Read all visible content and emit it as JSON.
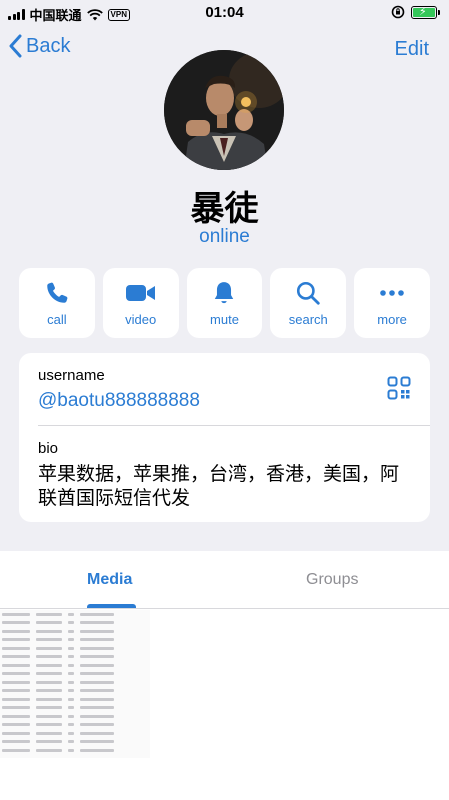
{
  "status_bar": {
    "carrier": "中国联通",
    "vpn": "VPN",
    "time": "01:04"
  },
  "nav": {
    "back_label": "Back",
    "edit_label": "Edit"
  },
  "profile": {
    "name": "暴徒",
    "status": "online"
  },
  "actions": [
    {
      "label": "call",
      "icon": "phone-icon"
    },
    {
      "label": "video",
      "icon": "video-icon"
    },
    {
      "label": "mute",
      "icon": "bell-icon"
    },
    {
      "label": "search",
      "icon": "search-icon"
    },
    {
      "label": "more",
      "icon": "more-icon"
    }
  ],
  "info": {
    "username_label": "username",
    "username_value": "@baotu888888888",
    "bio_label": "bio",
    "bio_value": "苹果数据，苹果推，台湾，香港，美国，阿联酋国际短信代发"
  },
  "tabs": [
    {
      "label": "Media",
      "active": true
    },
    {
      "label": "Groups",
      "active": false
    }
  ],
  "colors": {
    "accent": "#2b7cd3",
    "background": "#efeff4",
    "card": "#ffffff",
    "battery": "#34c759"
  }
}
